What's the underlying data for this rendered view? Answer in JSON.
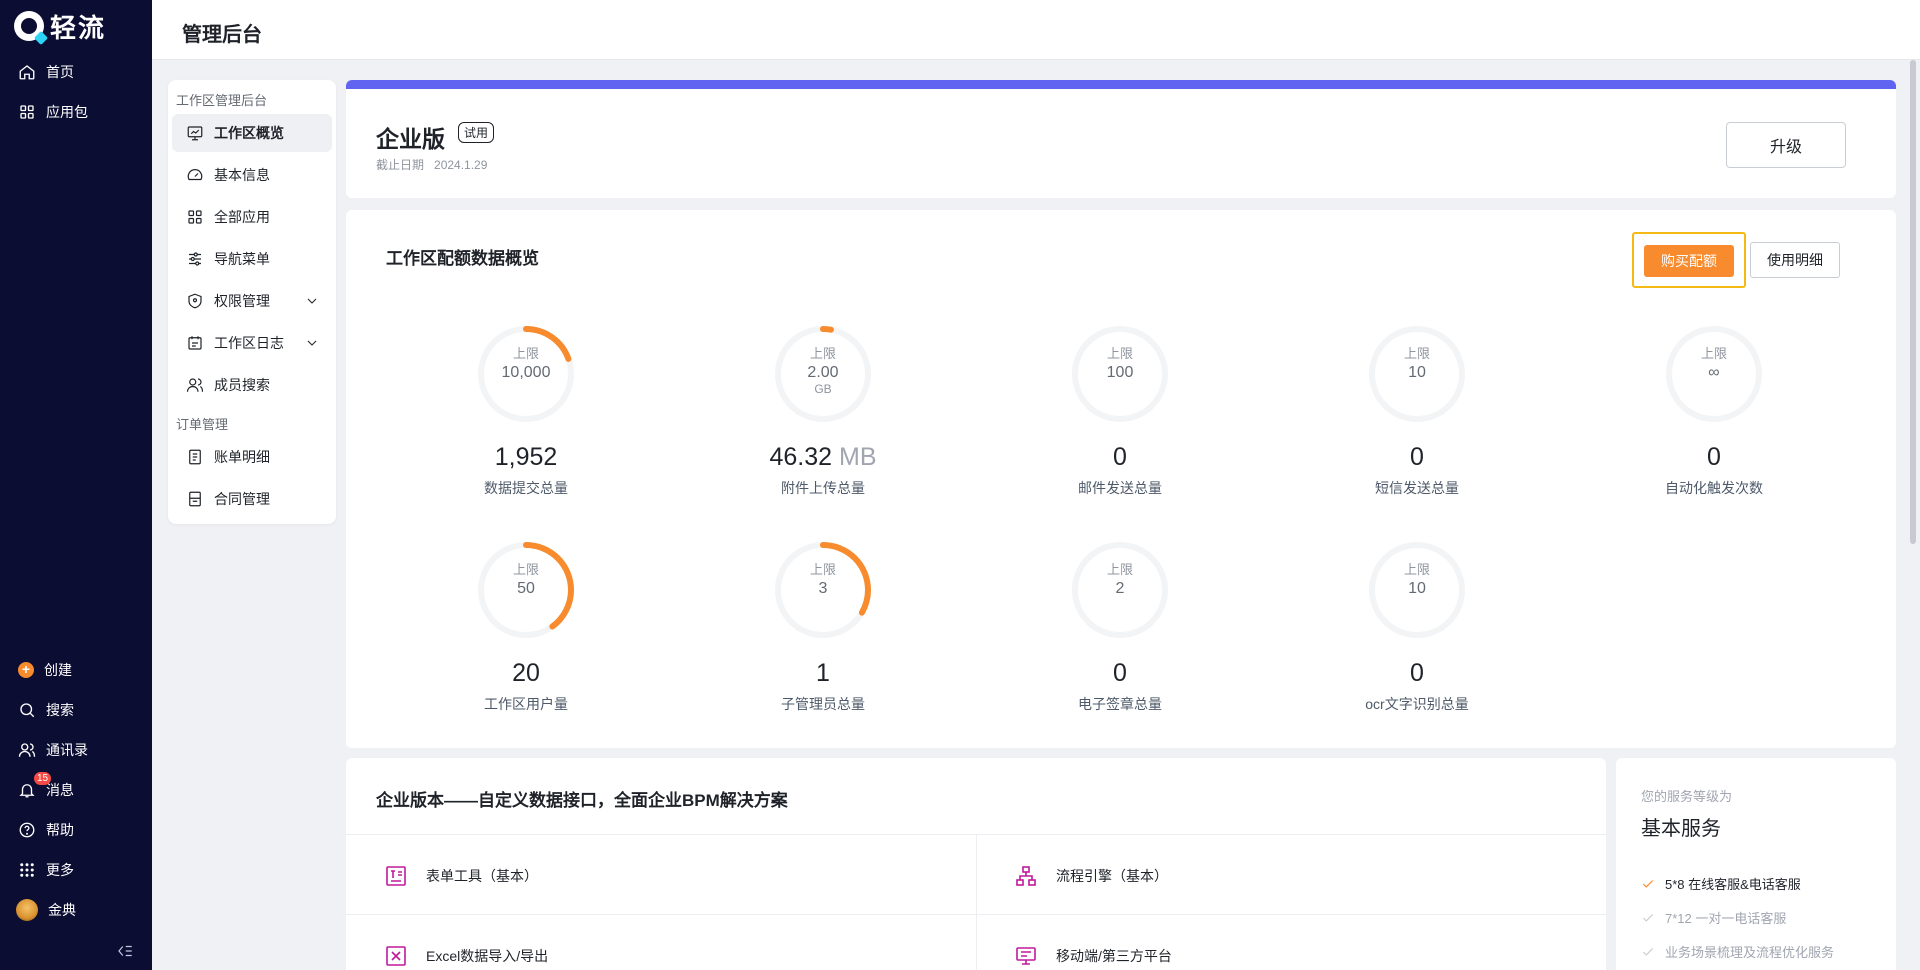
{
  "app": {
    "logo_text": "轻流",
    "page_title": "管理后台"
  },
  "leftnav": {
    "top": [
      {
        "label": "首页",
        "icon": "home-icon"
      },
      {
        "label": "应用包",
        "icon": "grid-icon"
      }
    ],
    "bottom": [
      {
        "label": "创建",
        "icon": "plus-circle-icon"
      },
      {
        "label": "搜索",
        "icon": "search-icon"
      },
      {
        "label": "通讯录",
        "icon": "contacts-icon"
      },
      {
        "label": "消息",
        "icon": "bell-icon",
        "badge": "15"
      },
      {
        "label": "帮助",
        "icon": "help-icon"
      },
      {
        "label": "更多",
        "icon": "dots-grid-icon"
      },
      {
        "label": "金典",
        "icon": "avatar"
      }
    ]
  },
  "submenu": {
    "group1": "工作区管理后台",
    "items1": [
      {
        "label": "工作区概览",
        "icon": "dashboard-icon",
        "active": true
      },
      {
        "label": "基本信息",
        "icon": "speedometer-icon"
      },
      {
        "label": "全部应用",
        "icon": "apps-icon"
      },
      {
        "label": "导航菜单",
        "icon": "sliders-icon"
      },
      {
        "label": "权限管理",
        "icon": "shield-icon",
        "expandable": true
      },
      {
        "label": "工作区日志",
        "icon": "calendar-icon",
        "expandable": true
      },
      {
        "label": "成员搜索",
        "icon": "users-icon"
      }
    ],
    "group2": "订单管理",
    "items2": [
      {
        "label": "账单明细",
        "icon": "bill-icon"
      },
      {
        "label": "合同管理",
        "icon": "contract-icon"
      }
    ]
  },
  "plan": {
    "name": "企业版",
    "tag": "试用",
    "expire_label": "截止日期",
    "expire_date": "2024.1.29",
    "upgrade": "升级"
  },
  "quota": {
    "title": "工作区配额数据概览",
    "buy": "购买配额",
    "usage": "使用明细",
    "limit_label": "上限",
    "accent": "#f78b2d",
    "metrics": [
      {
        "limit": "10,000",
        "unit": "",
        "value": "1,952",
        "value_unit": "",
        "label": "数据提交总量",
        "ratio": 0.1952
      },
      {
        "limit": "2.00",
        "unit": "GB",
        "value": "46.32",
        "value_unit": "MB",
        "label": "附件上传总量",
        "ratio": 0.0226
      },
      {
        "limit": "100",
        "unit": "",
        "value": "0",
        "value_unit": "",
        "label": "邮件发送总量",
        "ratio": 0
      },
      {
        "limit": "10",
        "unit": "",
        "value": "0",
        "value_unit": "",
        "label": "短信发送总量",
        "ratio": 0
      },
      {
        "limit": "∞",
        "unit": "",
        "value": "0",
        "value_unit": "",
        "label": "自动化触发次数",
        "ratio": 0
      },
      {
        "limit": "50",
        "unit": "",
        "value": "20",
        "value_unit": "",
        "label": "工作区用户量",
        "ratio": 0.4
      },
      {
        "limit": "3",
        "unit": "",
        "value": "1",
        "value_unit": "",
        "label": "子管理员总量",
        "ratio": 0.3333
      },
      {
        "limit": "2",
        "unit": "",
        "value": "0",
        "value_unit": "",
        "label": "电子签章总量",
        "ratio": 0
      },
      {
        "limit": "10",
        "unit": "",
        "value": "0",
        "value_unit": "",
        "label": "ocr文字识别总量",
        "ratio": 0
      }
    ]
  },
  "features": {
    "title": "企业版本——自定义数据接口，全面企业BPM解决方案",
    "items": [
      {
        "label": "表单工具（基本）",
        "icon": "form-icon"
      },
      {
        "label": "流程引擎（基本）",
        "icon": "flow-icon"
      },
      {
        "label": "Excel数据导入/导出",
        "icon": "excel-icon"
      },
      {
        "label": "移动端/第三方平台",
        "icon": "mobile-platform-icon"
      }
    ]
  },
  "service": {
    "label": "您的服务等级为",
    "title": "基本服务",
    "items": [
      {
        "text": "5*8 在线客服&电话客服",
        "enabled": true
      },
      {
        "text": "7*12 一对一电话客服",
        "enabled": false
      },
      {
        "text": "业务场景梳理及流程优化服务",
        "enabled": false
      }
    ]
  }
}
